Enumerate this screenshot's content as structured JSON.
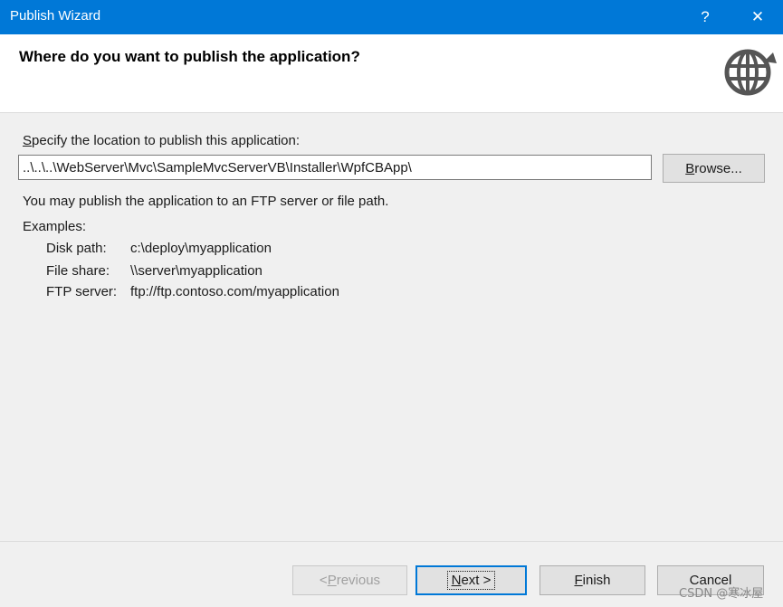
{
  "window": {
    "title": "Publish Wizard",
    "help_glyph": "?",
    "close_glyph": "✕"
  },
  "header": {
    "title": "Where do you want to publish the application?",
    "icon": "globe-publish-icon"
  },
  "location": {
    "label_accel": "S",
    "label_rest": "pecify the location to publish this application:",
    "path_value": "..\\..\\..\\WebServer\\Mvc\\SampleMvcServerVB\\Installer\\WpfCBApp\\",
    "browse_accel": "B",
    "browse_rest": "rowse..."
  },
  "info": {
    "text": "You may publish the application to an FTP server or file path.",
    "examples_label": "Examples:",
    "examples": [
      {
        "key": "Disk path:",
        "value": "c:\\deploy\\myapplication"
      },
      {
        "key": "File share:",
        "value": "\\\\server\\myapplication"
      },
      {
        "key": "FTP server:",
        "value": "ftp://ftp.contoso.com/myapplication"
      }
    ]
  },
  "footer": {
    "previous_prefix": "< ",
    "previous_accel": "P",
    "previous_rest": "revious",
    "next_accel": "N",
    "next_rest": "ext >",
    "finish_accel": "F",
    "finish_rest": "inish",
    "cancel_label": "Cancel"
  },
  "watermark": "CSDN @寒冰屋",
  "colors": {
    "titlebar": "#0078d7",
    "accent": "#0078d7",
    "globe": "#555555"
  }
}
